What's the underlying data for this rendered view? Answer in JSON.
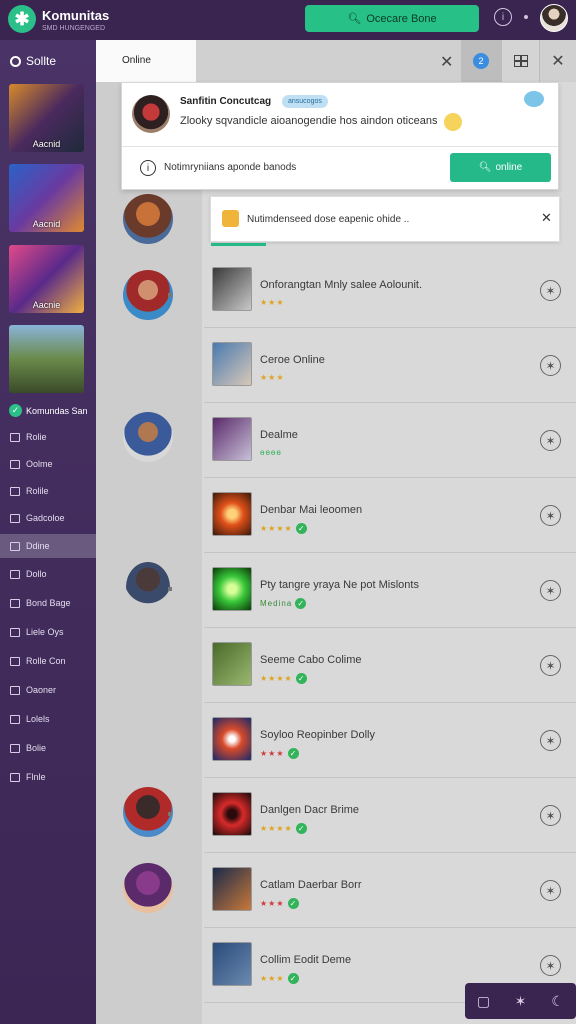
{
  "header": {
    "brand": "Komunitas",
    "brand_sub": "SMD HUNGENGED",
    "search_label": "Ocecare Bone",
    "logo_glyph": "✱",
    "info_glyph": "i"
  },
  "sidebar": {
    "title": "Sollte",
    "thumbs": [
      {
        "label": "Aacnid"
      },
      {
        "label": "Aacnid"
      },
      {
        "label": "Aacnie"
      },
      {
        "label": ""
      }
    ],
    "check_label": "Komundas San",
    "items": [
      {
        "label": "Rolie"
      },
      {
        "label": "Oolme"
      },
      {
        "label": "Rolile"
      },
      {
        "label": "Gadcoloe"
      },
      {
        "label": "Ddine"
      },
      {
        "label": "Dollo"
      },
      {
        "label": "Bond Bage"
      },
      {
        "label": "Liele Oys"
      },
      {
        "label": "Rolle Con"
      },
      {
        "label": "Oaoner"
      },
      {
        "label": "Lolels"
      },
      {
        "label": "Bolie"
      },
      {
        "label": "Flnle"
      }
    ]
  },
  "tabs": {
    "active_label": "Online",
    "badge_count": "2",
    "close_glyph": "✕"
  },
  "notification": {
    "title": "Sanfitin Concutcag",
    "tag": "ansucogos",
    "message": "Zlooky sqvandicle aioanogendie hos aindon oticeans",
    "sub": "Notimryniians aponde banods",
    "button_label": "online"
  },
  "alert": {
    "text": "Nutimdenseed dose eapenic ohide ..",
    "close_glyph": "✕"
  },
  "list": [
    {
      "title": "Onforangtan Mnly salee Aolounit.",
      "rating": "★★★",
      "badge": false,
      "star_color": "#e0a320"
    },
    {
      "title": "Ceroe Online",
      "rating": "★★★",
      "badge": false,
      "star_color": "#e0a320"
    },
    {
      "title": "Dealme",
      "rating": "ѳѳѳѳ",
      "badge": false,
      "star_color": "#33b35a"
    },
    {
      "title": "Denbar Mai leoomen",
      "rating": "★★★★",
      "badge": true,
      "star_color": "#e0a320"
    },
    {
      "title": "Pty tangre yraya Ne pot Mislonts",
      "rating": "Medina",
      "badge": true,
      "star_color": "#33b35a"
    },
    {
      "title": "Seeme Cabo Colime",
      "rating": "★★★★",
      "badge": true,
      "star_color": "#e0a320"
    },
    {
      "title": "Soyloo Reopinber Dolly",
      "rating": "★★★",
      "badge": true,
      "star_color": "#d23a3a"
    },
    {
      "title": "Danlgen Dacr Brime",
      "rating": "★★★★",
      "badge": true,
      "star_color": "#e0a320"
    },
    {
      "title": "Catlam Daerbar Borr",
      "rating": "★★★",
      "badge": true,
      "star_color": "#d23a3a"
    },
    {
      "title": "Collim Eodit Deme",
      "rating": "★★★",
      "badge": true,
      "star_color": "#e0a320"
    }
  ],
  "dock": {
    "chat_glyph": "▢",
    "star_glyph": "✶",
    "moon_glyph": "☾"
  }
}
